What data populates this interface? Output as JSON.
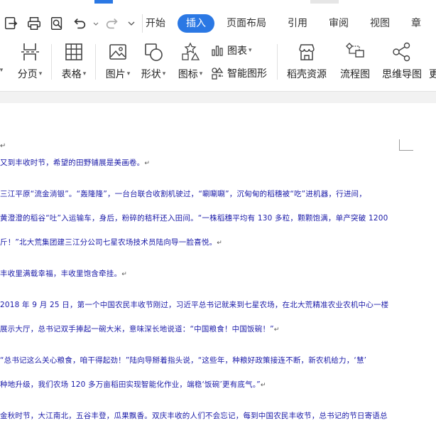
{
  "tabs": [
    {
      "label": "开始",
      "active": false
    },
    {
      "label": "插入",
      "active": true
    },
    {
      "label": "页面布局",
      "active": false
    },
    {
      "label": "引用",
      "active": false
    },
    {
      "label": "审阅",
      "active": false
    },
    {
      "label": "视图",
      "active": false
    },
    {
      "label": "章",
      "active": false
    }
  ],
  "quick_access": [
    "export-icon",
    "print-icon",
    "print-preview-icon",
    "undo-icon",
    "redo-icon",
    "customize-icon"
  ],
  "tools": {
    "page_break": "分页",
    "table": "表格",
    "picture": "图片",
    "shape": "形状",
    "icon": "图标",
    "chart": "图表",
    "smart_shape": "智能图形",
    "resources": "稻壳资源",
    "flowchart": "流程图",
    "mindmap": "思维导图",
    "more": "更"
  },
  "document": {
    "paragraph_mark": "↵",
    "lines": [
      "又到丰收时节，希望的田野铺展是美画卷。",
      "三江平原“流金淌银”。“轰隆隆”，一台台联合收割机驶过，“唰唰唰”，沉甸甸的稻穗被“吃”进机器，行进间，",
      "黄澄澄的稻谷“吐”入运输车，身后，粉碎的秸秆还入田间。“一株稻穗平均有 130 多粒，颗颗饱满，单产突破 1200",
      "斤！”北大荒集团建三江分公司七星农场技术员陆向导一脸喜悦。",
      "丰收里满载幸福，丰收里饱含牵挂。",
      "2018 年 9 月 25 日，第一个中国农民丰收节刚过，习近平总书记就来到七星农场，在北大荒精准农业农机中心一楼",
      "展示大厅，总书记双手捧起一碗大米，意味深长地说道：“中国粮食！中国饭碗！”",
      "“总书记这么关心粮食，咱干得起劲！”陆向导掰着指头说，“这些年，种粮好政策接连不断，新农机给力，‘慧’",
      "种地升级，我们农场 120 多万亩稻田实现智能化作业，端稳‘饭碗’更有底气。”",
      "金秋时节，大江南北，五谷丰登，瓜果飘香。双庆丰收的人们不会忘记，每到中国农民丰收节，总书记的节日寄语总"
    ]
  }
}
